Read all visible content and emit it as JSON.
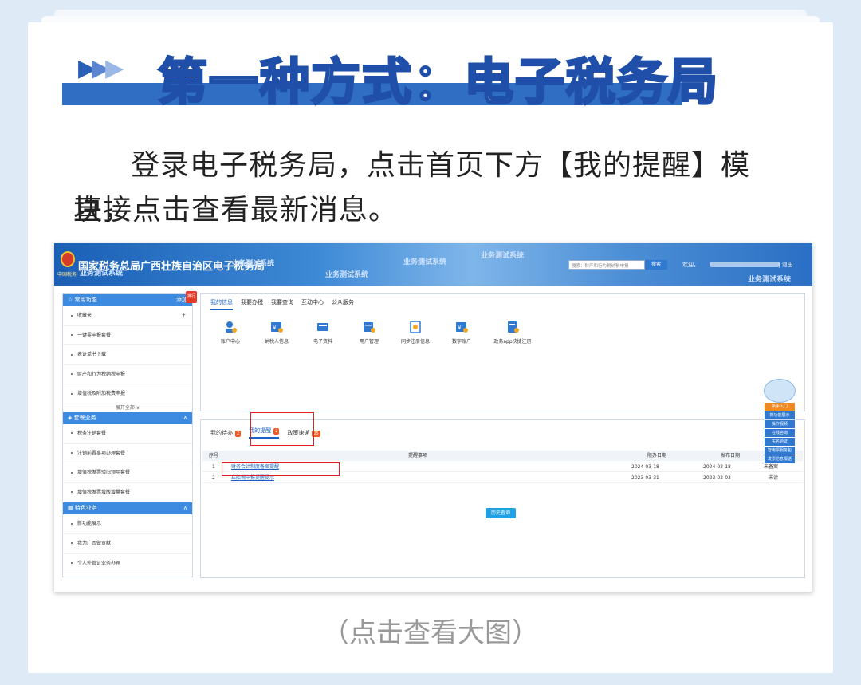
{
  "heading": {
    "title": "第一种方式：电子税务局"
  },
  "body_text": {
    "line1": "登录电子税务局，点击首页下方【我的提醒】模块，",
    "line2": "直接点击查看最新消息。"
  },
  "caption": "（点击查看大图）",
  "screenshot": {
    "site_title": "国家税务总局广西壮族自治区电子税务局",
    "emblem_text": "中国税务",
    "watermarks": [
      "业务测试系统",
      "业务测试系统",
      "业务测试系统",
      "业务测试系统",
      "业务测试系统",
      "业务测试系统"
    ],
    "search_placeholder": "搜索：财产和行为税纳税申报",
    "search_button": "搜索",
    "welcome": "欢迎，",
    "logout": "| 退出",
    "sidebar": {
      "common_header": "常用功能",
      "common_add": "添加",
      "common_badge": "排行",
      "common_items": [
        "收藏夹",
        "一键零申报套餐",
        "表证单书下载",
        "财产和行为税纳税申报",
        "增值税及附加税费申报"
      ],
      "expand_label": "展开全部 ∨",
      "package_header": "套餐业务",
      "package_items": [
        "税务注销套餐",
        "注销前置事项办理套餐",
        "增值税发票验旧领用套餐",
        "增值税发票增版增量套餐"
      ],
      "special_header": "特色业务",
      "special_items": [
        "新功能展示",
        "我为广西做贡献",
        "个人外管证业务办理"
      ]
    },
    "top_tabs": [
      "我的信息",
      "我要办税",
      "我要查询",
      "互动中心",
      "公众服务"
    ],
    "icons": [
      {
        "label": "账户中心",
        "icon": "account-center-icon"
      },
      {
        "label": "纳税人信息",
        "icon": "taxpayer-info-icon"
      },
      {
        "label": "电子资料",
        "icon": "e-document-icon"
      },
      {
        "label": "用户管理",
        "icon": "user-management-icon"
      },
      {
        "label": "同步注册信息",
        "icon": "sync-registration-icon"
      },
      {
        "label": "数字账户",
        "icon": "digital-account-icon"
      },
      {
        "label": "政务app快捷注册",
        "icon": "gov-app-register-icon"
      }
    ],
    "bottom_tabs": [
      {
        "label": "我的待办",
        "count": "2"
      },
      {
        "label": "我的提醒",
        "count": "2"
      },
      {
        "label": "政策速递",
        "count": "25"
      }
    ],
    "table": {
      "headers": [
        "序号",
        "提醒事项",
        "限办日期",
        "发布日期",
        ""
      ],
      "rows": [
        {
          "no": "1",
          "item": "财务会计制度备案提醒",
          "deadline": "2024-03-18",
          "published": "2024-02-18",
          "status": "未备案"
        },
        {
          "no": "2",
          "item": "车船税申报提醒提示",
          "deadline": "2023-03-31",
          "published": "2023-02-03",
          "status": "未读"
        }
      ]
    },
    "history_button": "历史查询",
    "float_buttons": [
      "新手入门",
      "新功能展示",
      "操作视频",
      "在线咨询",
      "实名验证",
      "智电票服务包",
      "发票信息报送"
    ]
  },
  "colors": {
    "accent": "#2f6ec2",
    "link": "#1a61c6",
    "highlight": "#e02020"
  }
}
